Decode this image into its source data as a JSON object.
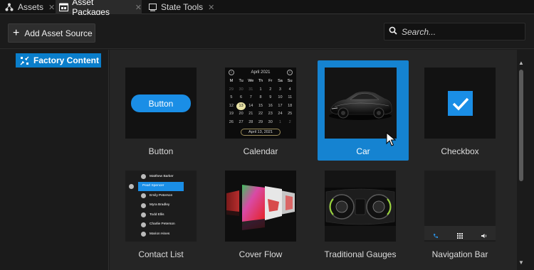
{
  "tabs": [
    {
      "label": "Assets",
      "icon": "assets-tree-icon",
      "active": false
    },
    {
      "label": "Asset Packages",
      "icon": "asset-packages-icon",
      "active": true
    },
    {
      "label": "State Tools",
      "icon": "state-tools-icon",
      "active": false
    }
  ],
  "toolbar": {
    "add_label": "Add Asset Source"
  },
  "search": {
    "placeholder": "Search..."
  },
  "sidebar": {
    "items": [
      {
        "label": "Factory Content",
        "icon": "factory-content-icon",
        "selected": true
      }
    ]
  },
  "calendar": {
    "month": "April 2021",
    "weekdays": [
      "M",
      "Tu",
      "We",
      "Th",
      "Fr",
      "Sa",
      "Su"
    ],
    "rows": [
      [
        "29",
        "30",
        "31",
        "1",
        "2",
        "3",
        "4"
      ],
      [
        "5",
        "6",
        "7",
        "8",
        "9",
        "10",
        "11"
      ],
      [
        "12",
        "13",
        "14",
        "15",
        "16",
        "17",
        "18"
      ],
      [
        "19",
        "20",
        "21",
        "22",
        "23",
        "24",
        "25"
      ],
      [
        "26",
        "27",
        "28",
        "29",
        "30",
        "1",
        "2"
      ]
    ],
    "selected": "April 13, 2021"
  },
  "button_preview": {
    "label": "Button"
  },
  "contact_list": {
    "names": [
      "Matthew Barker",
      "Pearl Spencer",
      "Emily Peterson",
      "Myra Bradley",
      "Todd Ellis",
      "Charlie Peterson",
      "Marion Hines"
    ],
    "selected_index": 1
  },
  "assets": [
    {
      "label": "Button",
      "selected": false
    },
    {
      "label": "Calendar",
      "selected": false
    },
    {
      "label": "Car",
      "selected": true
    },
    {
      "label": "Checkbox",
      "selected": false
    },
    {
      "label": "Contact List",
      "selected": false
    },
    {
      "label": "Cover Flow",
      "selected": false
    },
    {
      "label": "Traditional Gauges",
      "selected": false
    },
    {
      "label": "Navigation Bar",
      "selected": false
    }
  ],
  "colors": {
    "accent": "#1583d1",
    "selection": "#0a7ecb",
    "background": "#1b1b1b",
    "content_bg": "#252525"
  }
}
